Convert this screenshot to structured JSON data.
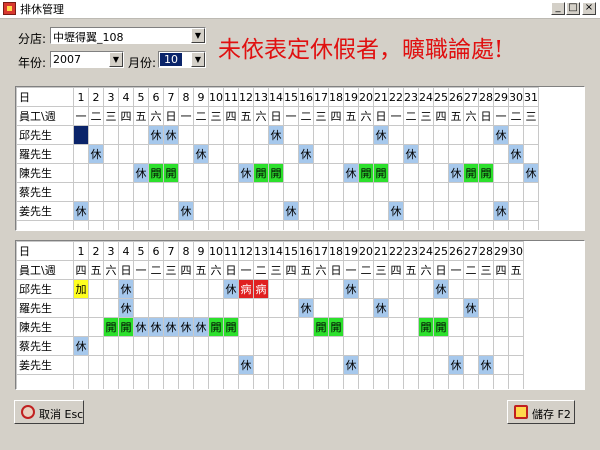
{
  "window": {
    "title": "排休管理",
    "min": "_",
    "max": "□",
    "close": "×"
  },
  "filters": {
    "branch_label": "分店:",
    "branch_value": "中壢得翼_108",
    "year_label": "年份:",
    "year_value": "2007",
    "month_label": "月份:",
    "month_value": "10"
  },
  "warning": "未依表定休假者，曠職論處!",
  "top_grid": {
    "day_label": "日",
    "week_label": "員工\\週",
    "days": [
      "1",
      "2",
      "3",
      "4",
      "5",
      "6",
      "7",
      "8",
      "9",
      "10",
      "11",
      "12",
      "13",
      "14",
      "15",
      "16",
      "17",
      "18",
      "19",
      "20",
      "21",
      "22",
      "23",
      "24",
      "25",
      "26",
      "27",
      "28",
      "29",
      "30",
      "31"
    ],
    "weekdays": [
      "一",
      "二",
      "三",
      "四",
      "五",
      "六",
      "日",
      "一",
      "二",
      "三",
      "四",
      "五",
      "六",
      "日",
      "一",
      "二",
      "三",
      "四",
      "五",
      "六",
      "日",
      "一",
      "二",
      "三",
      "四",
      "五",
      "六",
      "日",
      "一",
      "二",
      "三"
    ],
    "rows": [
      {
        "name": "邱先生",
        "cells": [
          "cur",
          "",
          "",
          "",
          "",
          "休",
          "休",
          "",
          "",
          "",
          "",
          "",
          "",
          "休",
          "",
          "",
          "",
          "",
          "",
          "",
          "休",
          "",
          "",
          "",
          "",
          "",
          "",
          "",
          "休",
          "",
          ""
        ]
      },
      {
        "name": "羅先生",
        "cells": [
          "",
          "休",
          "",
          "",
          "",
          "",
          "",
          "",
          "休",
          "",
          "",
          "",
          "",
          "",
          "",
          "休",
          "",
          "",
          "",
          "",
          "",
          "",
          "休",
          "",
          "",
          "",
          "",
          "",
          "",
          "休",
          ""
        ]
      },
      {
        "name": "陳先生",
        "cells": [
          "",
          "",
          "",
          "",
          "休",
          "開",
          "開",
          "",
          "",
          "",
          "",
          "休",
          "開",
          "開",
          "",
          "",
          "",
          "",
          "休",
          "開",
          "開",
          "",
          "",
          "",
          "",
          "休",
          "開",
          "開",
          "",
          "",
          "休"
        ]
      },
      {
        "name": "蔡先生",
        "cells": [
          "",
          "",
          "",
          "",
          "",
          "",
          "",
          "",
          "",
          "",
          "",
          "",
          "",
          "",
          "",
          "",
          "",
          "",
          "",
          "",
          "",
          "",
          "",
          "",
          "",
          "",
          "",
          "",
          "",
          "",
          ""
        ]
      },
      {
        "name": "姜先生",
        "cells": [
          "休",
          "",
          "",
          "",
          "",
          "",
          "",
          "休",
          "",
          "",
          "",
          "",
          "",
          "",
          "休",
          "",
          "",
          "",
          "",
          "",
          "",
          "休",
          "",
          "",
          "",
          "",
          "",
          "",
          "休",
          "",
          ""
        ]
      }
    ]
  },
  "bottom_grid": {
    "day_label": "日",
    "week_label": "員工\\週",
    "days": [
      "1",
      "2",
      "3",
      "4",
      "5",
      "6",
      "7",
      "8",
      "9",
      "10",
      "11",
      "12",
      "13",
      "14",
      "15",
      "16",
      "17",
      "18",
      "19",
      "20",
      "21",
      "22",
      "23",
      "24",
      "25",
      "26",
      "27",
      "28",
      "29",
      "30"
    ],
    "weekdays": [
      "四",
      "五",
      "六",
      "日",
      "一",
      "二",
      "三",
      "四",
      "五",
      "六",
      "日",
      "一",
      "二",
      "三",
      "四",
      "五",
      "六",
      "日",
      "一",
      "二",
      "三",
      "四",
      "五",
      "六",
      "日",
      "一",
      "二",
      "三",
      "四",
      "五"
    ],
    "rows": [
      {
        "name": "邱先生",
        "cells": [
          "加",
          "",
          "",
          "休",
          "",
          "",
          "",
          "",
          "",
          "",
          "休",
          "病",
          "病",
          "",
          "",
          "",
          "",
          "",
          "休",
          "",
          "",
          "",
          "",
          "",
          "休",
          "",
          "",
          "",
          "",
          ""
        ]
      },
      {
        "name": "羅先生",
        "cells": [
          "",
          "",
          "",
          "休",
          "",
          "",
          "",
          "",
          "",
          "",
          "",
          "",
          "",
          "",
          "",
          "休",
          "",
          "",
          "",
          "",
          "休",
          "",
          "",
          "",
          "",
          "",
          "休",
          "",
          "",
          ""
        ]
      },
      {
        "name": "陳先生",
        "cells": [
          "",
          "",
          "開",
          "開",
          "休",
          "休",
          "休",
          "休",
          "休",
          "開",
          "開",
          "",
          "",
          "",
          "",
          "",
          "開",
          "開",
          "",
          "",
          "",
          "",
          "",
          "開",
          "開",
          "",
          "",
          "",
          "",
          ""
        ]
      },
      {
        "name": "蔡先生",
        "cells": [
          "休",
          "",
          "",
          "",
          "",
          "",
          "",
          "",
          "",
          "",
          "",
          "",
          "",
          "",
          "",
          "",
          "",
          "",
          "",
          "",
          "",
          "",
          "",
          "",
          "",
          "",
          "",
          "",
          "",
          ""
        ]
      },
      {
        "name": "姜先生",
        "cells": [
          "",
          "",
          "",
          "",
          "",
          "",
          "",
          "",
          "",
          "",
          "",
          "休",
          "",
          "",
          "",
          "",
          "",
          "",
          "休",
          "",
          "",
          "",
          "",
          "",
          "",
          "休",
          "",
          "休",
          "",
          ""
        ]
      }
    ]
  },
  "buttons": {
    "cancel": "取消 Esc",
    "save": "儲存 F2"
  },
  "colors": {
    "leave": "#a6c8ec",
    "pre": "#2ce02c",
    "sick": "#e02020",
    "overtime": "#ffff20",
    "warning": "#e01010"
  }
}
